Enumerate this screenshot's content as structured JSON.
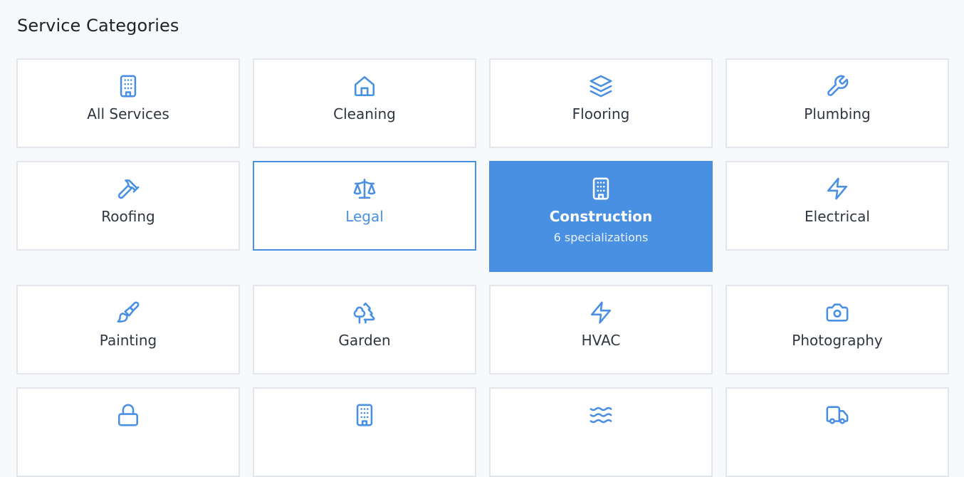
{
  "header": {
    "title": "Service Categories"
  },
  "categories": [
    {
      "label": "All Services",
      "icon": "building-icon"
    },
    {
      "label": "Cleaning",
      "icon": "home-icon"
    },
    {
      "label": "Flooring",
      "icon": "layers-icon"
    },
    {
      "label": "Plumbing",
      "icon": "wrench-icon"
    },
    {
      "label": "Roofing",
      "icon": "hammer-icon"
    },
    {
      "label": "Legal",
      "icon": "scale-icon"
    },
    {
      "label": "Construction",
      "icon": "building-icon",
      "sub": "6 specializations"
    },
    {
      "label": "Electrical",
      "icon": "zap-icon"
    },
    {
      "label": "Painting",
      "icon": "paintbrush-icon"
    },
    {
      "label": "Garden",
      "icon": "trees-icon"
    },
    {
      "label": "HVAC",
      "icon": "zap-icon"
    },
    {
      "label": "Photography",
      "icon": "camera-icon"
    },
    {
      "label": "",
      "icon": "lock-icon"
    },
    {
      "label": "",
      "icon": "building-icon"
    },
    {
      "label": "",
      "icon": "waves-icon"
    },
    {
      "label": "",
      "icon": "truck-icon"
    }
  ],
  "colors": {
    "accent": "#4a90e2",
    "border": "#e3e6ea",
    "background": "#f8f9fb"
  }
}
